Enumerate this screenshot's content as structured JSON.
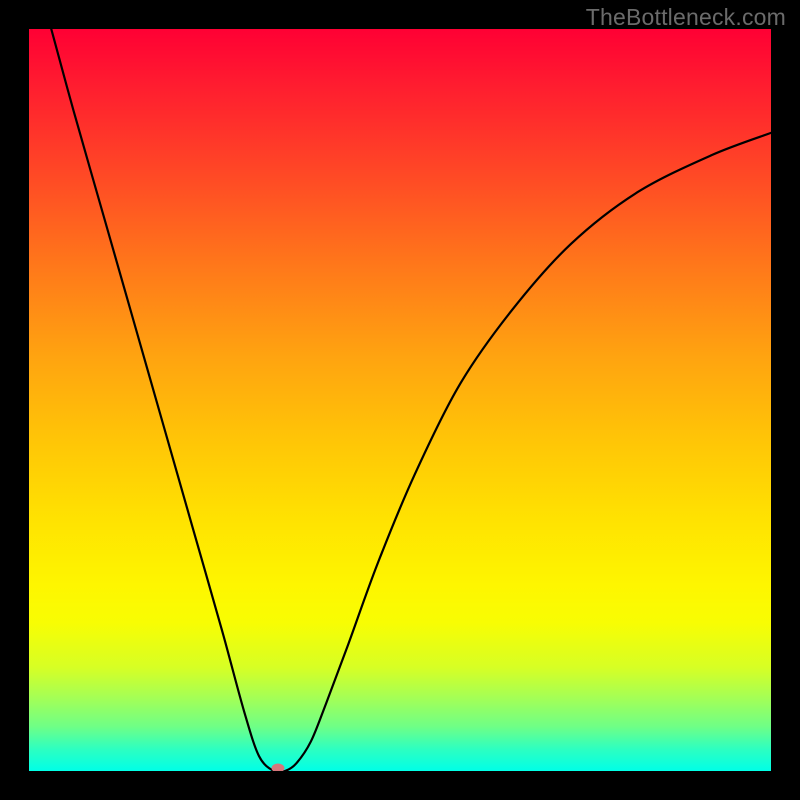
{
  "watermark": "TheBottleneck.com",
  "colors": {
    "page_bg": "#000000",
    "curve": "#000000",
    "dot": "#d6777c",
    "gradient_top": "#ff0034",
    "gradient_bottom": "#00ffe7"
  },
  "chart_data": {
    "type": "line",
    "title": "",
    "xlabel": "",
    "ylabel": "",
    "xlim": [
      0,
      100
    ],
    "ylim": [
      0,
      100
    ],
    "grid": false,
    "series": [
      {
        "name": "bottleneck-curve",
        "x": [
          3,
          6,
          10,
          14,
          18,
          22,
          26,
          29,
          31,
          33,
          34.5,
          36,
          38,
          40,
          43,
          47,
          52,
          58,
          65,
          73,
          82,
          92,
          100
        ],
        "y": [
          100,
          89,
          75,
          61,
          47,
          33,
          19,
          8,
          2,
          0,
          0,
          1,
          4,
          9,
          17,
          28,
          40,
          52,
          62,
          71,
          78,
          83,
          86
        ]
      }
    ],
    "annotations": [
      {
        "name": "min-point-dot",
        "x": 33.5,
        "y": 0
      }
    ],
    "legend": false
  }
}
